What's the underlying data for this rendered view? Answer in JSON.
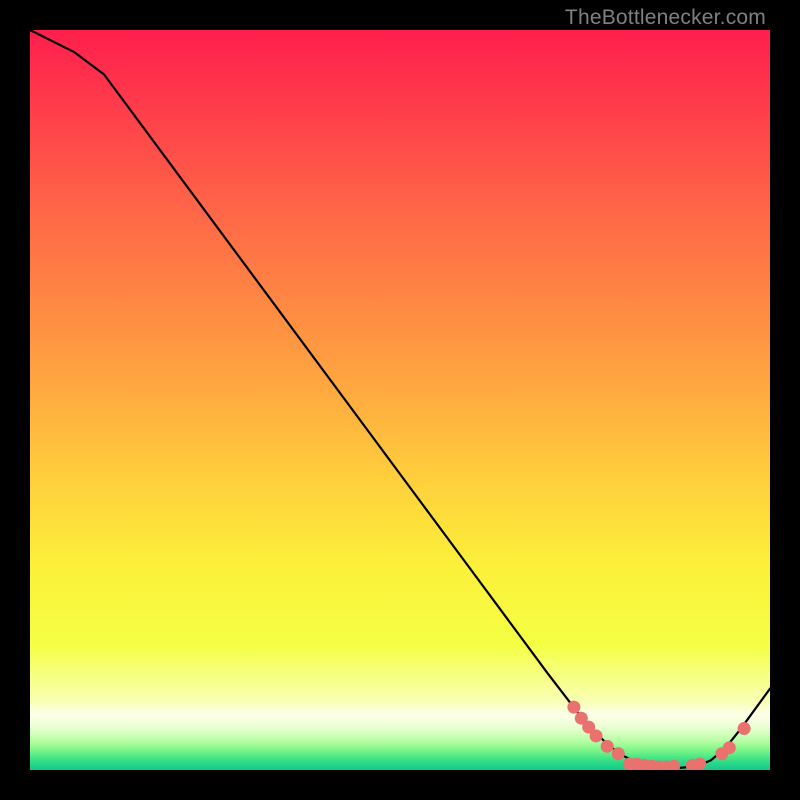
{
  "watermark": "TheBottlenecker.com",
  "chart_data": {
    "type": "line",
    "title": "",
    "xlabel": "",
    "ylabel": "",
    "xlim": [
      0,
      100
    ],
    "ylim": [
      0,
      100
    ],
    "series": [
      {
        "name": "curve",
        "x": [
          0,
          6,
          10,
          20,
          30,
          40,
          50,
          60,
          70,
          75,
          78,
          80,
          82,
          84,
          86,
          88,
          90,
          92,
          94,
          96,
          100
        ],
        "y": [
          100,
          97,
          94,
          80.5,
          67,
          53.5,
          40,
          26.5,
          13,
          6.5,
          3.5,
          2,
          1,
          0.5,
          0.3,
          0.3,
          0.5,
          1.3,
          3,
          5.5,
          11
        ]
      }
    ],
    "markers": [
      {
        "name": "dots",
        "color": "#e9716e",
        "points": [
          {
            "x": 73.5,
            "y": 8.5
          },
          {
            "x": 74.5,
            "y": 7.0
          },
          {
            "x": 75.5,
            "y": 5.8
          },
          {
            "x": 76.5,
            "y": 4.6
          },
          {
            "x": 78.0,
            "y": 3.2
          },
          {
            "x": 79.5,
            "y": 2.2
          },
          {
            "x": 81.0,
            "y": 0.8
          },
          {
            "x": 82.0,
            "y": 0.8
          },
          {
            "x": 83.0,
            "y": 0.6
          },
          {
            "x": 84.0,
            "y": 0.5
          },
          {
            "x": 85.0,
            "y": 0.4
          },
          {
            "x": 86.0,
            "y": 0.4
          },
          {
            "x": 87.0,
            "y": 0.5
          },
          {
            "x": 89.5,
            "y": 0.6
          },
          {
            "x": 90.5,
            "y": 0.8
          },
          {
            "x": 93.5,
            "y": 2.2
          },
          {
            "x": 94.5,
            "y": 3.0
          },
          {
            "x": 96.5,
            "y": 5.6
          }
        ]
      }
    ],
    "background_gradient": {
      "stops": [
        {
          "offset": 0.0,
          "color": "#ff1f4c"
        },
        {
          "offset": 0.1,
          "color": "#ff3b4b"
        },
        {
          "offset": 0.22,
          "color": "#ff5f48"
        },
        {
          "offset": 0.35,
          "color": "#ff8344"
        },
        {
          "offset": 0.48,
          "color": "#ffa740"
        },
        {
          "offset": 0.6,
          "color": "#ffcd3c"
        },
        {
          "offset": 0.72,
          "color": "#fcef3a"
        },
        {
          "offset": 0.83,
          "color": "#f5ff44"
        },
        {
          "offset": 0.905,
          "color": "#f8ffb0"
        },
        {
          "offset": 0.925,
          "color": "#feffe8"
        },
        {
          "offset": 0.938,
          "color": "#f0ffd8"
        },
        {
          "offset": 0.95,
          "color": "#d7ffbf"
        },
        {
          "offset": 0.962,
          "color": "#b1fea0"
        },
        {
          "offset": 0.972,
          "color": "#82f68a"
        },
        {
          "offset": 0.982,
          "color": "#4fe886"
        },
        {
          "offset": 0.99,
          "color": "#2bd988"
        },
        {
          "offset": 1.0,
          "color": "#15c98a"
        }
      ]
    }
  }
}
